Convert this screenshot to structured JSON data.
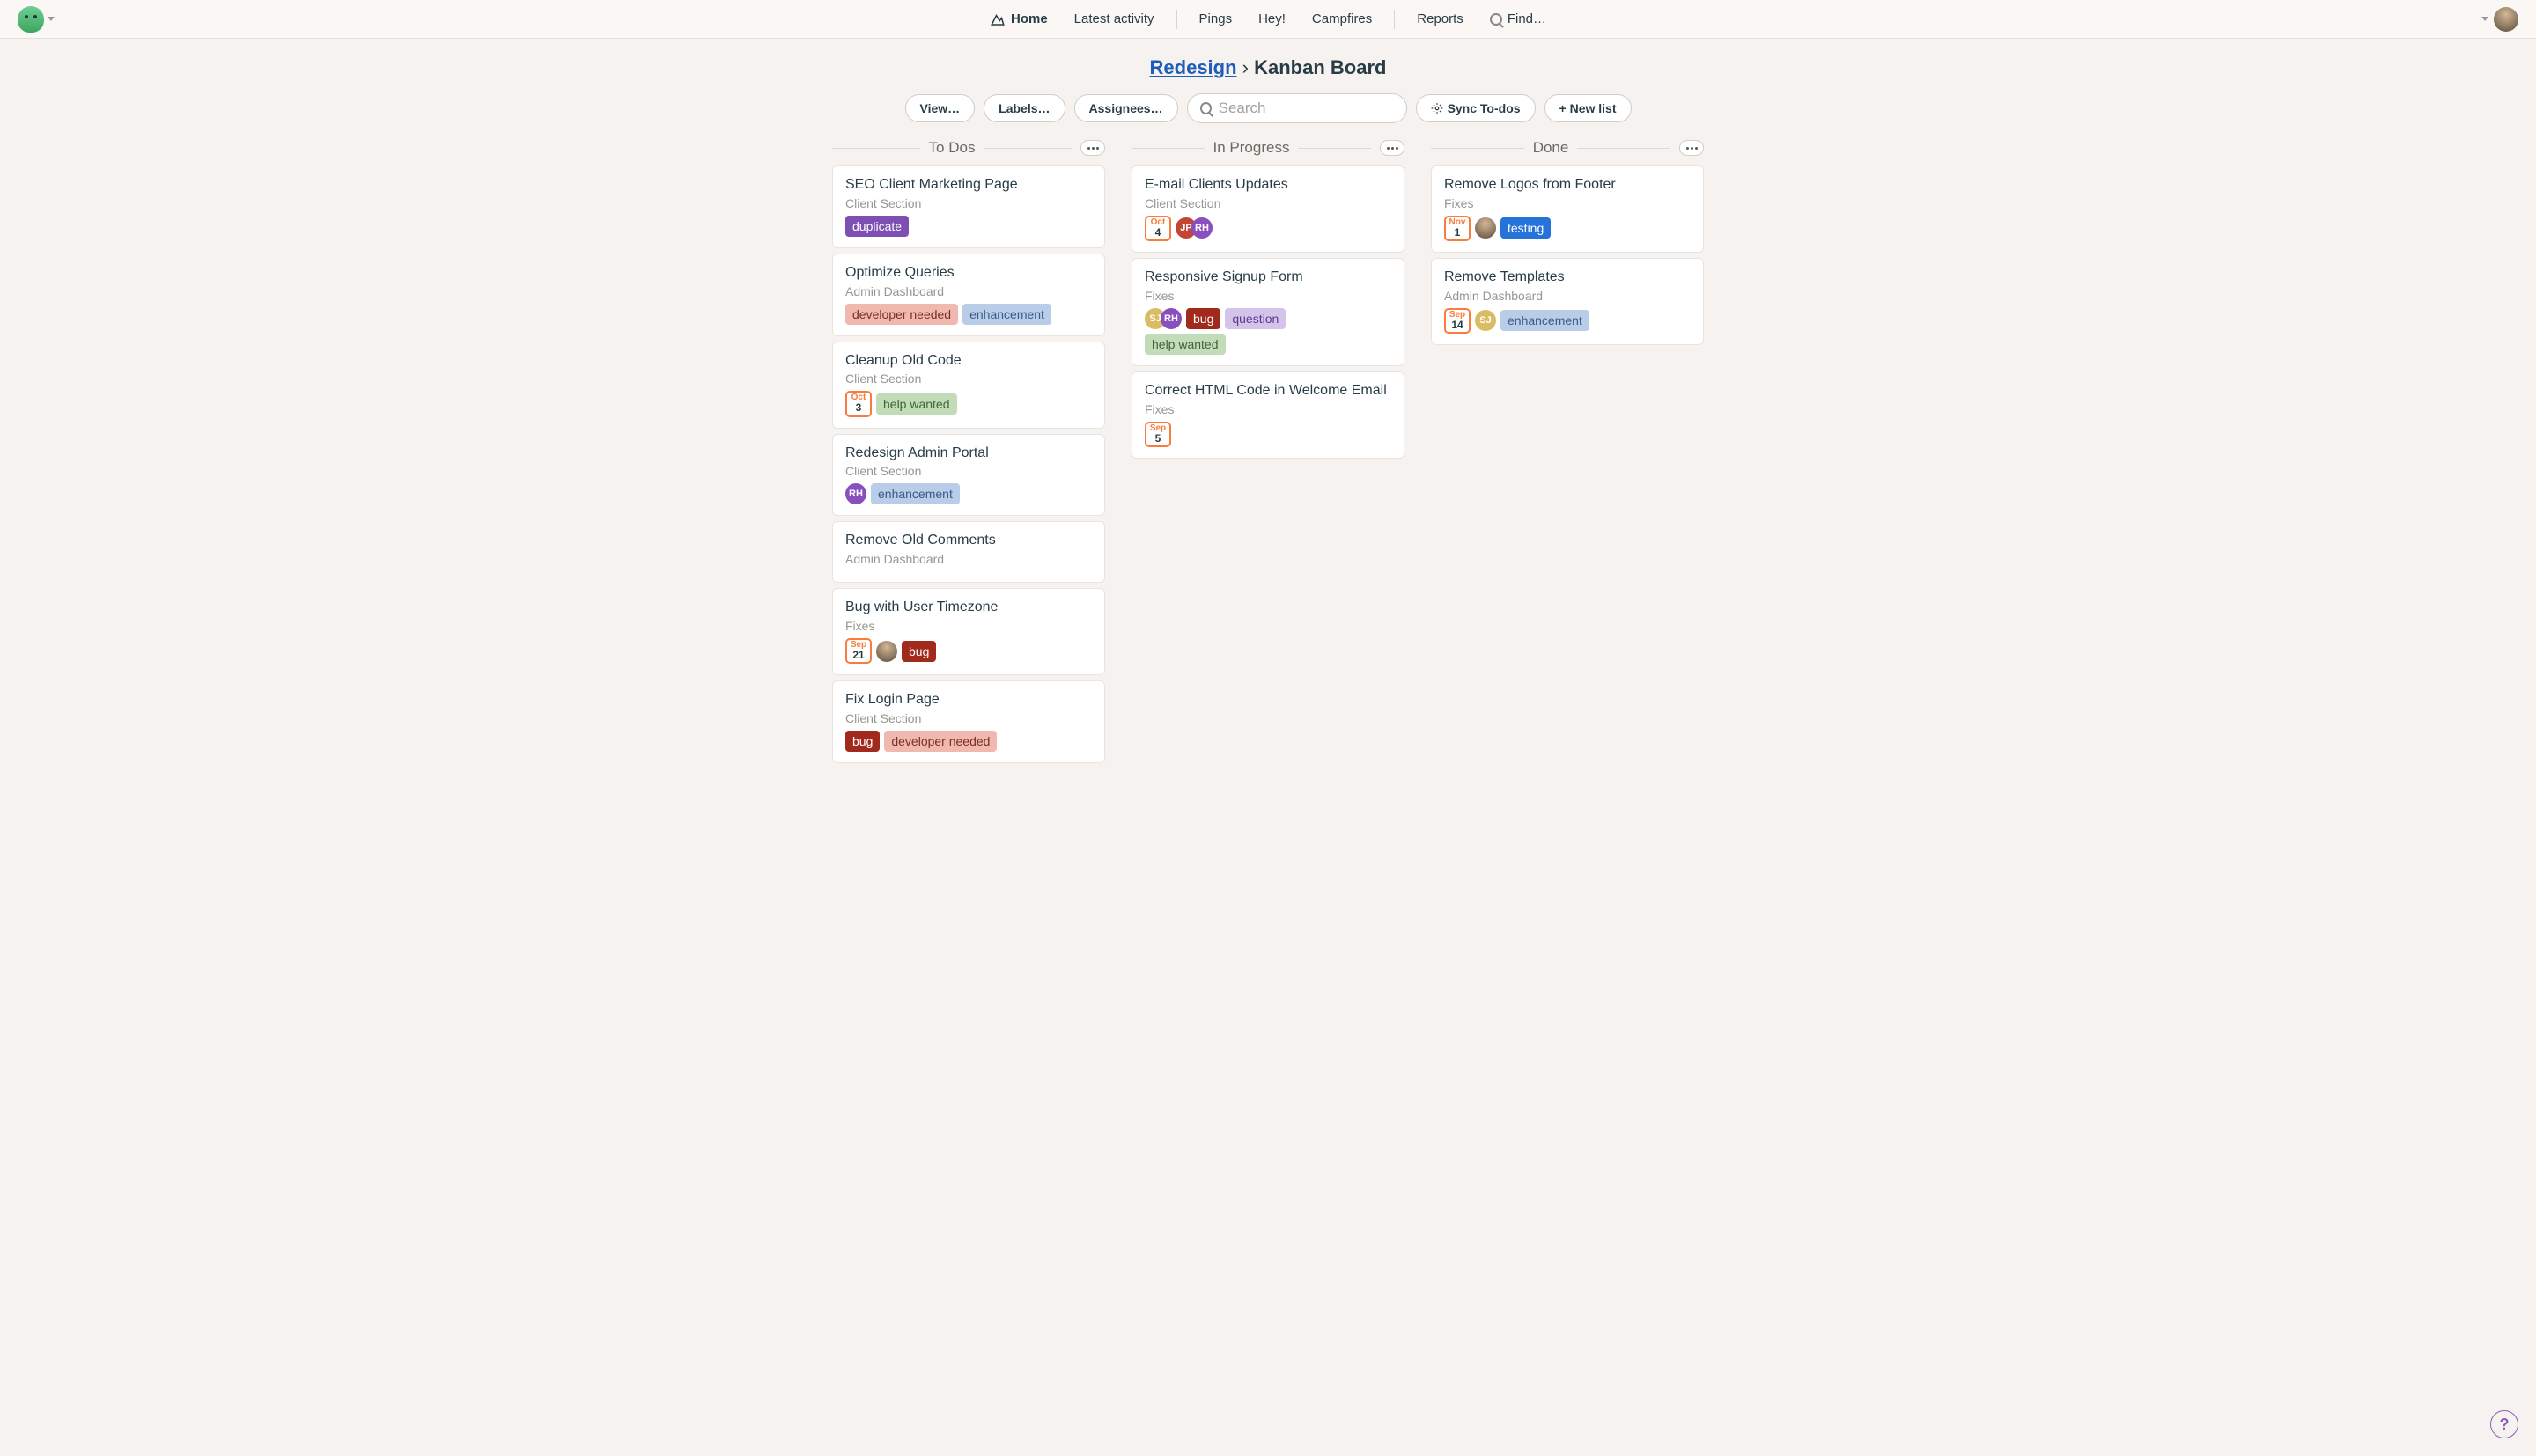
{
  "nav": {
    "home": "Home",
    "latest": "Latest activity",
    "pings": "Pings",
    "hey": "Hey!",
    "campfires": "Campfires",
    "reports": "Reports",
    "find": "Find…"
  },
  "breadcrumb": {
    "parent": "Redesign",
    "sep": "›",
    "current": "Kanban Board"
  },
  "toolbar": {
    "view": "View…",
    "labels": "Labels…",
    "assignees": "Assignees…",
    "search_placeholder": "Search",
    "sync": "Sync To-dos",
    "newlist": "+ New list"
  },
  "columns": [
    {
      "title": "To Dos",
      "cards": [
        {
          "title": "SEO Client Marketing Page",
          "sub": "Client Section",
          "labels": [
            {
              "cls": "l-duplicate",
              "text": "duplicate"
            }
          ]
        },
        {
          "title": "Optimize Queries",
          "sub": "Admin Dashboard",
          "labels": [
            {
              "cls": "l-devneeded",
              "text": "developer needed"
            },
            {
              "cls": "l-enhance",
              "text": "enhancement"
            }
          ]
        },
        {
          "title": "Cleanup Old Code",
          "sub": "Client Section",
          "date": {
            "m": "Oct",
            "d": "3"
          },
          "labels": [
            {
              "cls": "l-helpwanted",
              "text": "help wanted"
            }
          ]
        },
        {
          "title": "Redesign Admin Portal",
          "sub": "Client Section",
          "people": [
            {
              "cls": "p-purple",
              "text": "RH"
            }
          ],
          "labels": [
            {
              "cls": "l-enhance",
              "text": "enhancement"
            }
          ]
        },
        {
          "title": "Remove Old Comments",
          "sub": "Admin Dashboard"
        },
        {
          "title": "Bug with User Timezone",
          "sub": "Fixes",
          "date": {
            "m": "Sep",
            "d": "21"
          },
          "people": [
            {
              "cls": "p-photo",
              "text": ""
            }
          ],
          "labels": [
            {
              "cls": "l-bug",
              "text": "bug"
            }
          ]
        },
        {
          "title": "Fix Login Page",
          "sub": "Client Section",
          "labels": [
            {
              "cls": "l-bug",
              "text": "bug"
            },
            {
              "cls": "l-devneeded",
              "text": "developer needed"
            }
          ]
        }
      ]
    },
    {
      "title": "In Progress",
      "cards": [
        {
          "title": "E-mail Clients Updates",
          "sub": "Client Section",
          "date": {
            "m": "Oct",
            "d": "4"
          },
          "people": [
            {
              "cls": "p-red",
              "text": "JP"
            },
            {
              "cls": "p-purple",
              "text": "RH"
            }
          ]
        },
        {
          "title": "Responsive Signup Form",
          "sub": "Fixes",
          "people": [
            {
              "cls": "p-yellow",
              "text": "SJ"
            },
            {
              "cls": "p-purple",
              "text": "RH"
            }
          ],
          "labels": [
            {
              "cls": "l-bug",
              "text": "bug"
            },
            {
              "cls": "l-question",
              "text": "question"
            }
          ],
          "labels2": [
            {
              "cls": "l-helpwanted",
              "text": "help wanted"
            }
          ]
        },
        {
          "title": "Correct HTML Code in Welcome Email",
          "sub": "Fixes",
          "date": {
            "m": "Sep",
            "d": "5"
          }
        }
      ]
    },
    {
      "title": "Done",
      "cards": [
        {
          "title": "Remove Logos from Footer",
          "sub": "Fixes",
          "date": {
            "m": "Nov",
            "d": "1"
          },
          "people": [
            {
              "cls": "p-photo",
              "text": ""
            }
          ],
          "labels": [
            {
              "cls": "l-testing",
              "text": "testing"
            }
          ]
        },
        {
          "title": "Remove Templates",
          "sub": "Admin Dashboard",
          "date": {
            "m": "Sep",
            "d": "14"
          },
          "people": [
            {
              "cls": "p-yellow",
              "text": "SJ"
            }
          ],
          "labels": [
            {
              "cls": "l-enhance",
              "text": "enhancement"
            }
          ]
        }
      ]
    }
  ],
  "help": "?"
}
